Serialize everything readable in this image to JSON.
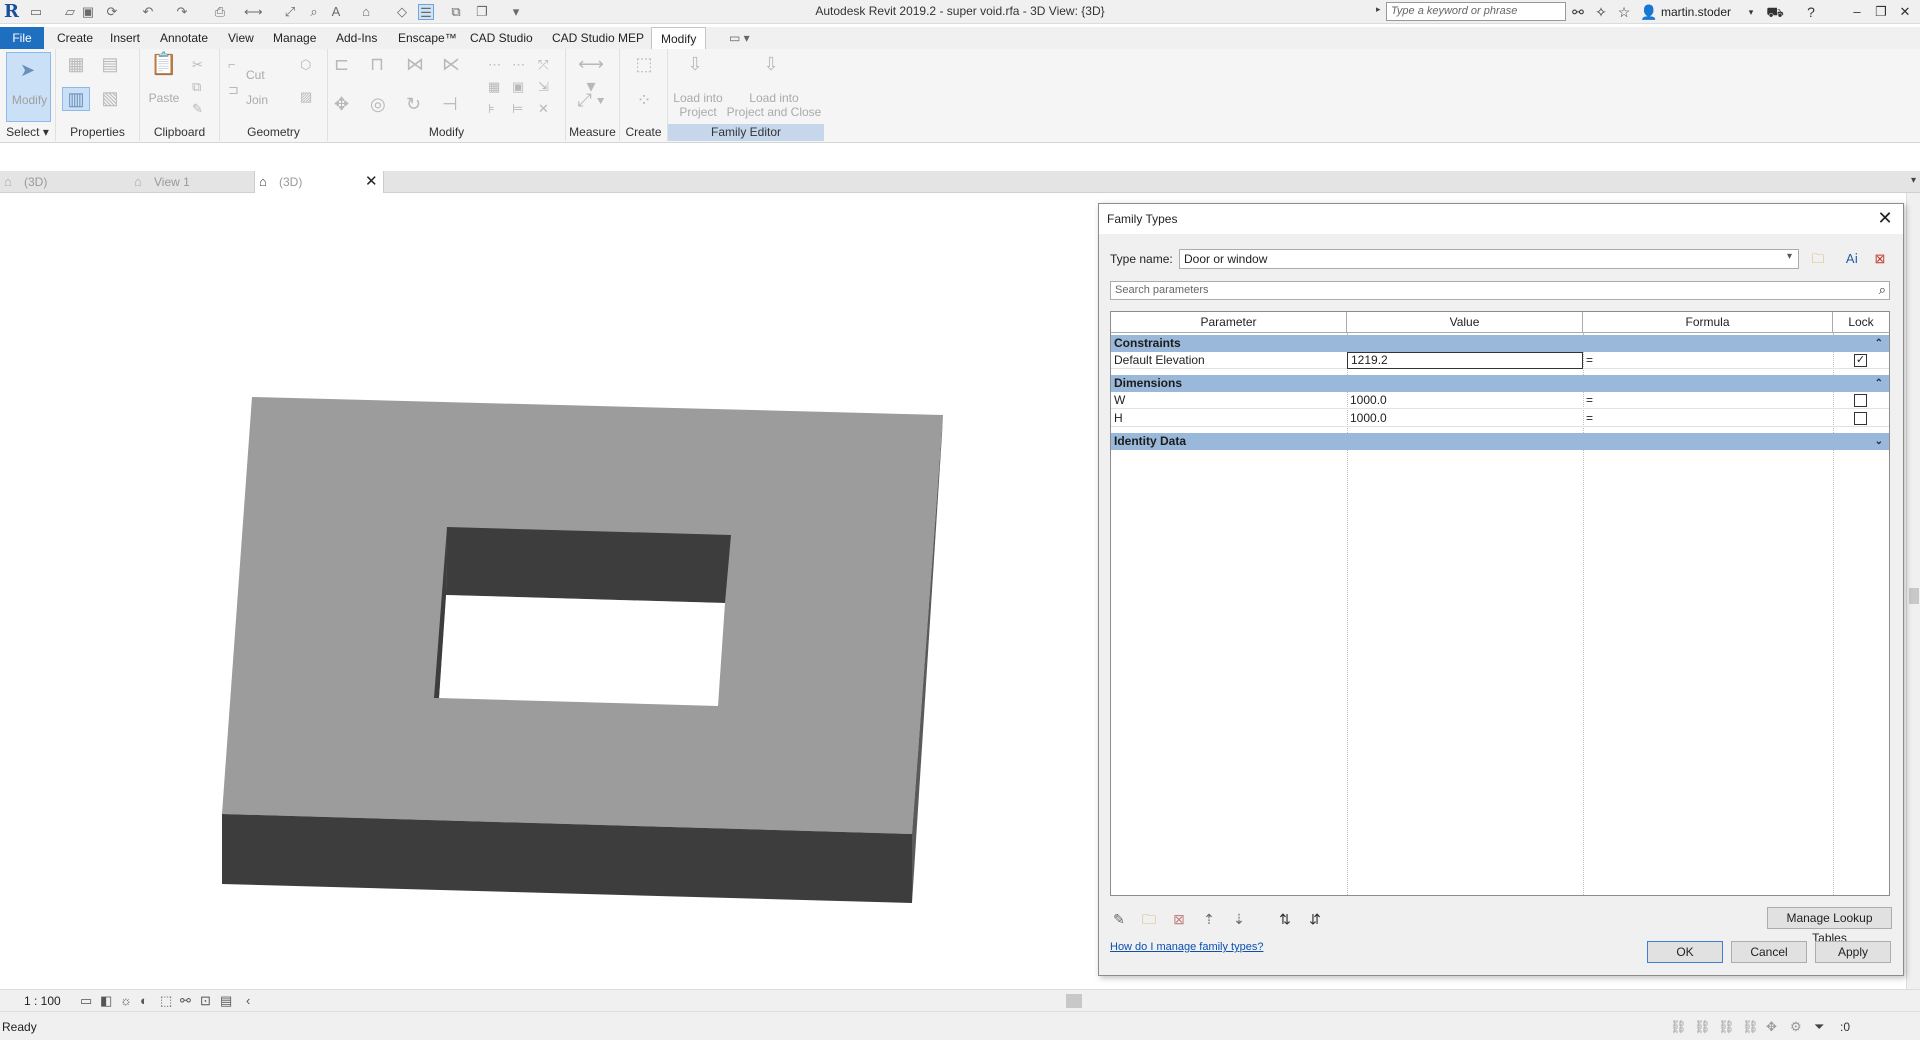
{
  "window": {
    "title": "Autodesk Revit 2019.2 - super void.rfa - 3D View: {3D}",
    "search_placeholder": "Type a keyword or phrase",
    "user": "martin.stoder"
  },
  "ribbon": {
    "tabs": [
      "File",
      "Create",
      "Insert",
      "Annotate",
      "View",
      "Manage",
      "Add-Ins",
      "Enscape™",
      "CAD Studio",
      "CAD Studio MEP",
      "Modify"
    ],
    "active_tab": "Modify",
    "groups": {
      "select": "Select",
      "properties": "Properties",
      "clipboard": "Clipboard",
      "geometry": "Geometry",
      "modify": "Modify",
      "measure": "Measure",
      "create": "Create",
      "family_editor": "Family Editor"
    },
    "buttons": {
      "modify": "Modify",
      "paste": "Paste",
      "cut": "Cut",
      "join": "Join",
      "load_into_project_1": "Load into",
      "load_into_project_2": "Project",
      "load_close_1": "Load into",
      "load_close_2": "Project and Close"
    }
  },
  "view_tabs": [
    {
      "label": "(3D)",
      "active": false
    },
    {
      "label": "View 1",
      "active": false
    },
    {
      "label": "(3D)",
      "active": true
    }
  ],
  "view_control": {
    "scale": "1 : 100"
  },
  "status": {
    "text": "Ready",
    "filter_count": ":0"
  },
  "dialog": {
    "title": "Family Types",
    "type_name_label": "Type name:",
    "type_name_value": "Door or window",
    "search_placeholder": "Search parameters",
    "columns": [
      "Parameter",
      "Value",
      "Formula",
      "Lock"
    ],
    "groups": [
      {
        "name": "Constraints",
        "rows": [
          {
            "parameter": "Default Elevation",
            "value": "1219.2",
            "formula": "=",
            "locked": true
          }
        ]
      },
      {
        "name": "Dimensions",
        "rows": [
          {
            "parameter": "W",
            "value": "1000.0",
            "formula": "=",
            "locked": false
          },
          {
            "parameter": "H",
            "value": "1000.0",
            "formula": "=",
            "locked": false
          }
        ]
      },
      {
        "name": "Identity Data",
        "rows": []
      }
    ],
    "manage_lookup_label": "Manage Lookup Tables",
    "help_link": "How do I manage family types?",
    "ok_label": "OK",
    "cancel_label": "Cancel",
    "apply_label": "Apply"
  },
  "colors": {
    "file_tab": "#1f6fc0",
    "group_header": "#9ab8d9",
    "model_top": "#9c9c9c",
    "model_side": "#3d3d3d"
  }
}
